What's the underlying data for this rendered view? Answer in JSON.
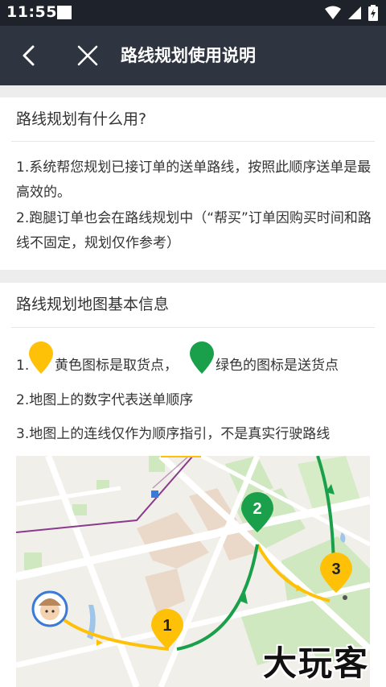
{
  "status_bar": {
    "time": "11:55"
  },
  "header": {
    "title": "路线规划使用说明"
  },
  "section1": {
    "title": "路线规划有什么用?",
    "items": [
      "1.系统帮您规划已接订单的送单路线，按照此顺序送单是最高效的。",
      "2.跑腿订单也会在路线规划中（“帮买”订单因购买时间和路线不固定，规划仅作参考）"
    ]
  },
  "section2": {
    "title": "路线规划地图基本信息",
    "legend_prefix": "1.",
    "legend_yellow": "黄色图标是取货点，",
    "legend_green": "绿色的图标是送货点",
    "items": [
      "2.地图上的数字代表送单顺序",
      "3.地图上的连线仅作为顺序指引，不是真实行驶路线"
    ]
  },
  "map": {
    "stop_1": "1",
    "stop_2": "2",
    "stop_3": "3"
  },
  "colors": {
    "yellow": "#ffc107",
    "green": "#1aa04a",
    "header_bg": "#2e3440"
  },
  "watermark": "大玩客"
}
